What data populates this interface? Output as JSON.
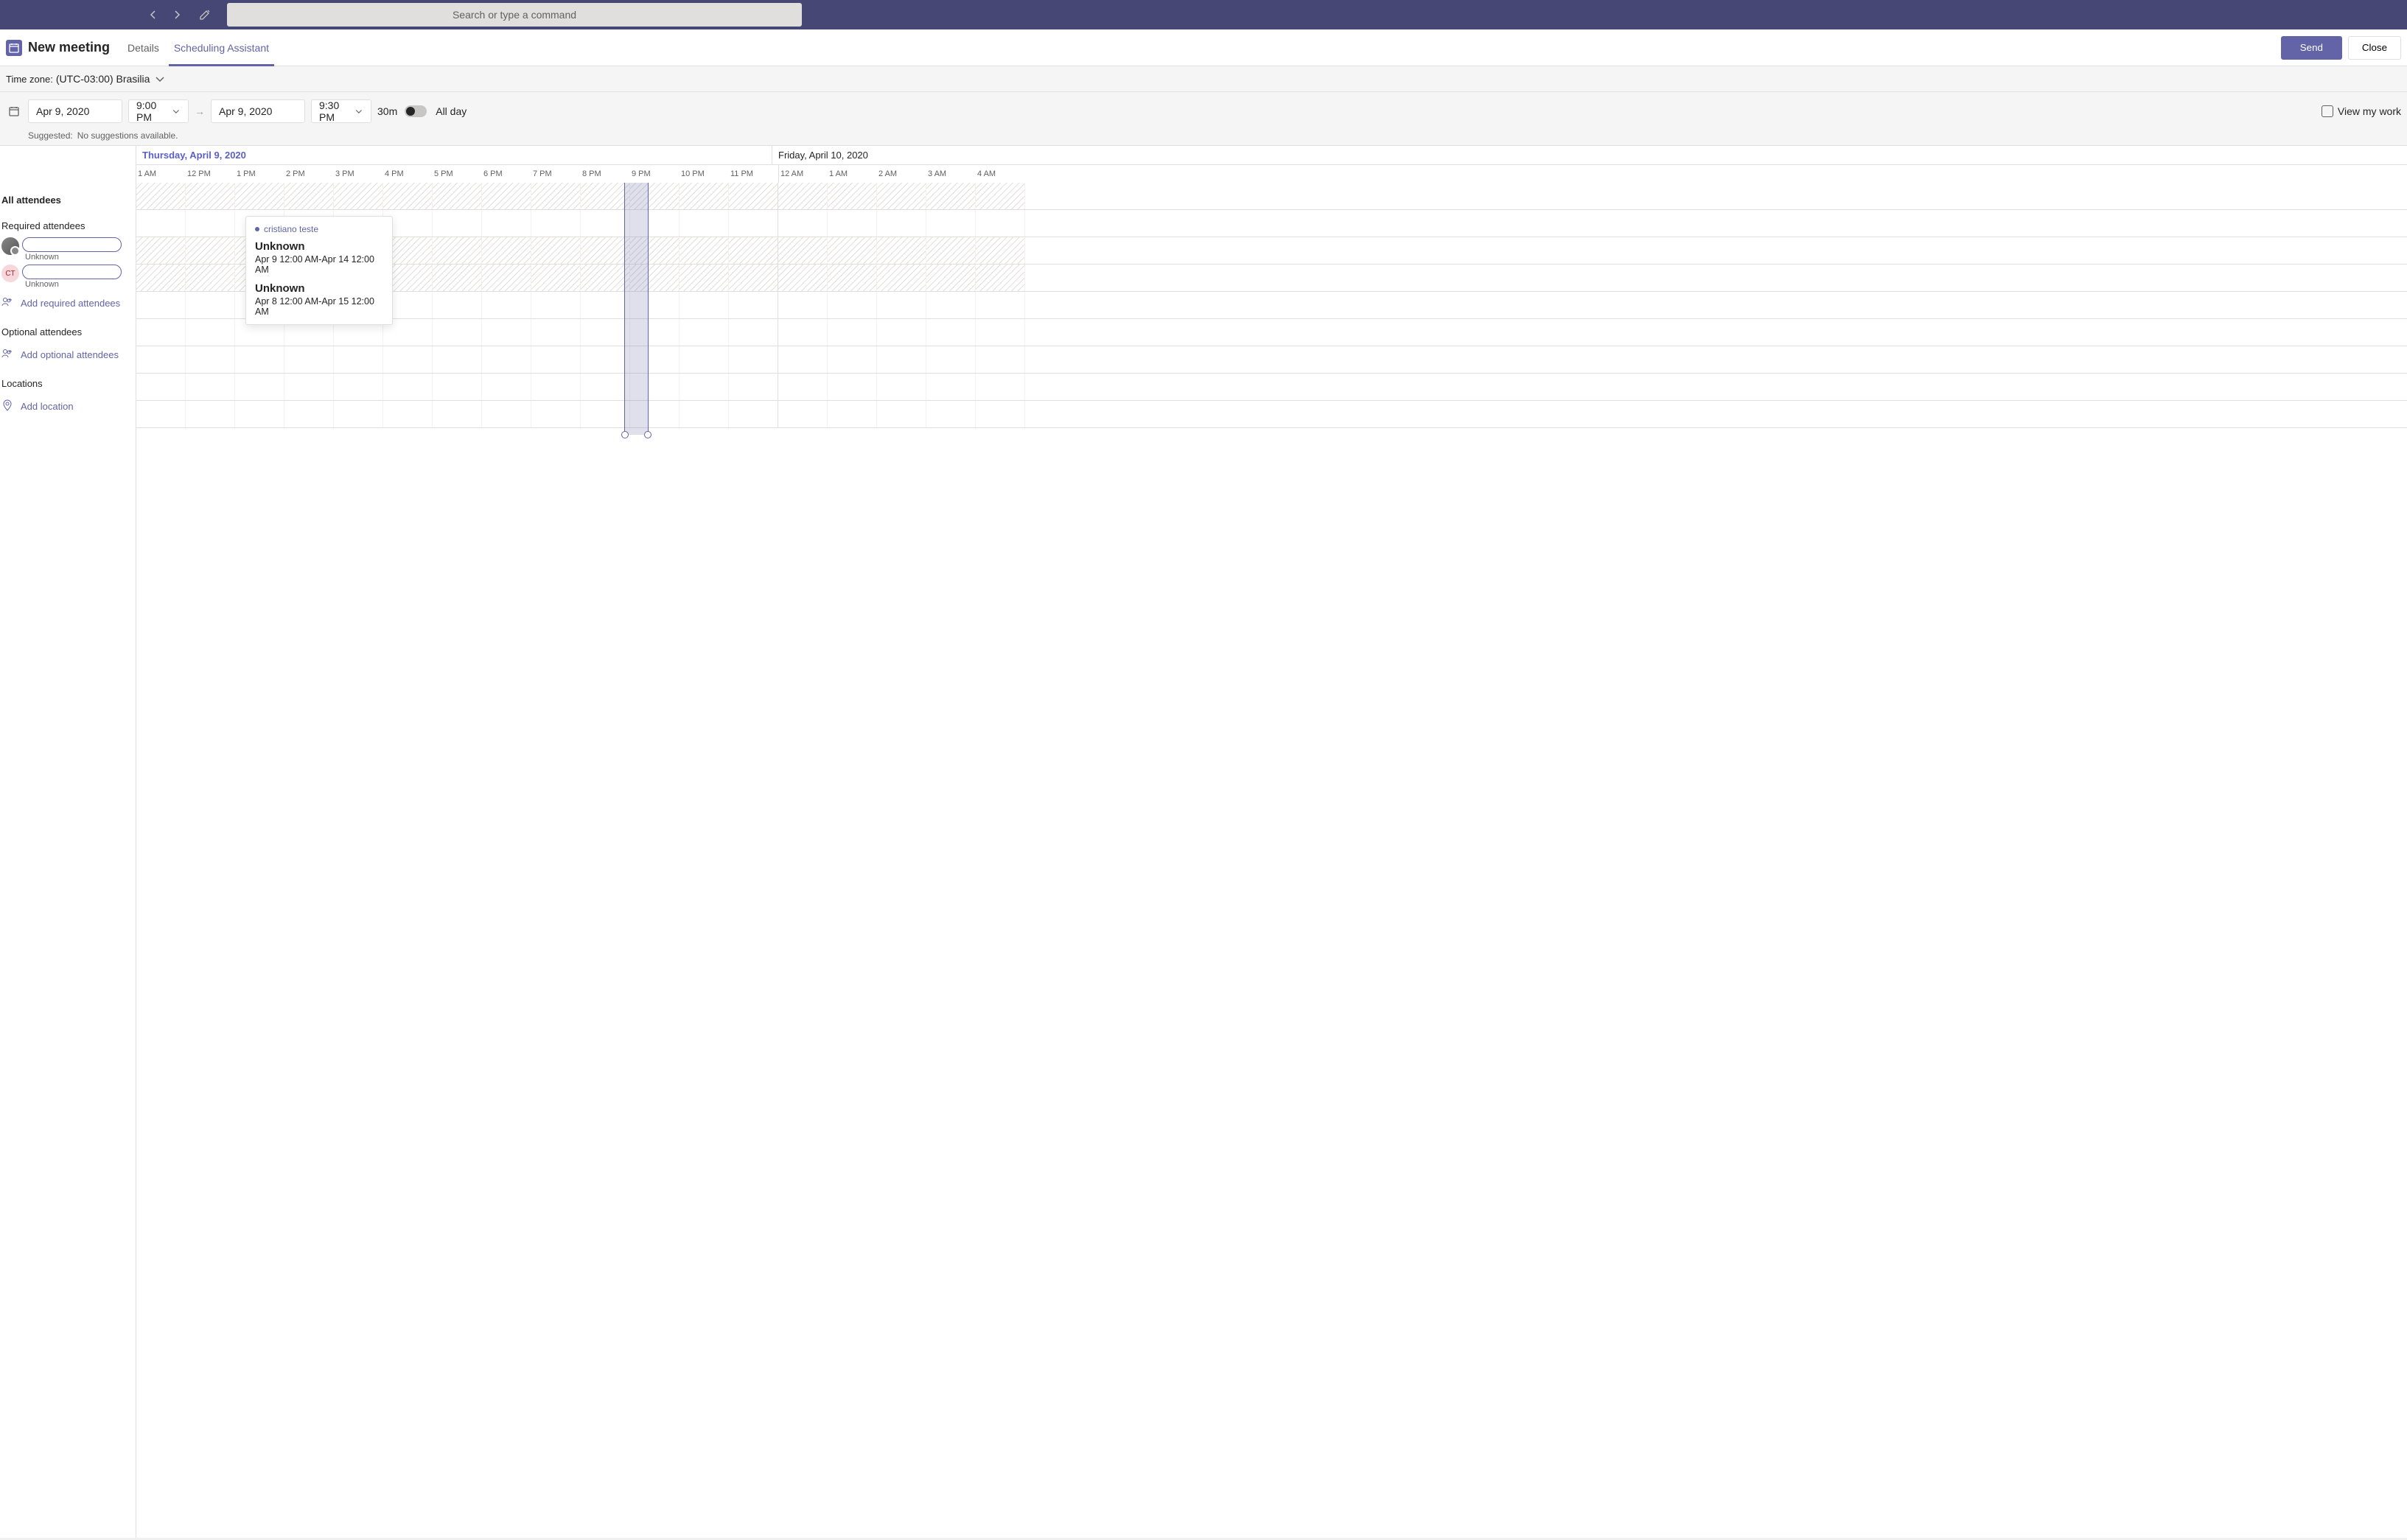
{
  "titlebar": {
    "search_placeholder": "Search or type a command"
  },
  "header": {
    "title": "New meeting",
    "tabs": {
      "details": "Details",
      "scheduling": "Scheduling Assistant"
    },
    "send": "Send",
    "close": "Close"
  },
  "timezone": {
    "label": "Time zone:",
    "value": "(UTC-03:00) Brasilia"
  },
  "datetime": {
    "start_date": "Apr 9, 2020",
    "start_time": "9:00 PM",
    "end_date": "Apr 9, 2020",
    "end_time": "9:30 PM",
    "duration": "30m",
    "allday_label": "All day",
    "viewwork_label": "View my work"
  },
  "suggest": {
    "label": "Suggested:",
    "value": "No suggestions available."
  },
  "days": {
    "thursday": "Thursday, April 9, 2020",
    "friday": "Friday, April 10, 2020"
  },
  "hours": [
    "1 AM",
    "12 PM",
    "1 PM",
    "2 PM",
    "3 PM",
    "4 PM",
    "5 PM",
    "6 PM",
    "7 PM",
    "8 PM",
    "9 PM",
    "10 PM",
    "11 PM",
    "12 AM",
    "1 AM",
    "2 AM",
    "3 AM",
    "4 AM"
  ],
  "sidebar": {
    "all": "All attendees",
    "required": "Required attendees",
    "optional": "Optional attendees",
    "locations": "Locations",
    "add_required": "Add required attendees",
    "add_optional": "Add optional attendees",
    "add_location": "Add location",
    "unknown": "Unknown",
    "ct_initials": "CT"
  },
  "tooltip": {
    "name": "cristiano teste",
    "events": [
      {
        "title": "Unknown",
        "time": "Apr 9 12:00 AM-Apr 14 12:00 AM"
      },
      {
        "title": "Unknown",
        "time": "Apr 8 12:00 AM-Apr 15 12:00 AM"
      }
    ]
  }
}
